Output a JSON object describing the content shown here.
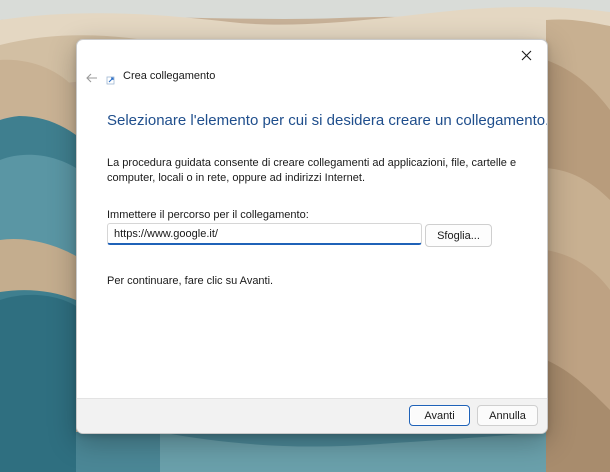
{
  "window": {
    "title": "Crea collegamento"
  },
  "wizard": {
    "heading": "Selezionare l'elemento per cui si desidera creare un collegamento.",
    "description": "La procedura guidata consente di creare collegamenti ad applicazioni, file, cartelle e computer, locali o in rete, oppure ad indirizzi Internet.",
    "path_label": "Immettere il percorso per il collegamento:",
    "path_value": "https://www.google.it/",
    "browse_label": "Sfoglia...",
    "continue_hint": "Per continuare, fare clic su Avanti."
  },
  "footer": {
    "next_label": "Avanti",
    "cancel_label": "Annulla"
  },
  "icons": {
    "close": "close-icon",
    "back": "back-arrow-icon",
    "title": "shortcut-icon"
  },
  "colors": {
    "heading": "#1f4e8c",
    "accent": "#1f62b8"
  }
}
